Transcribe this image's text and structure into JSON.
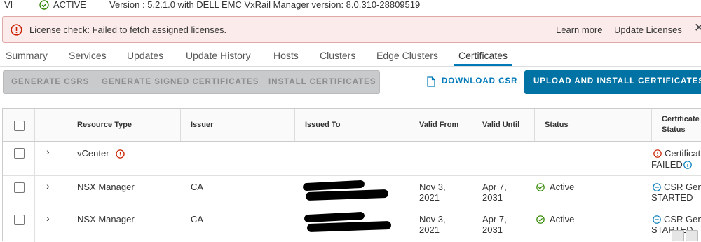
{
  "top": {
    "vi_label": "VI",
    "status": "ACTIVE",
    "version": "Version : 5.2.1.0 with DELL EMC VxRail Manager version: 8.0.310-28809519"
  },
  "alert": {
    "message": "License check: Failed to fetch assigned licenses.",
    "learn_more": "Learn more",
    "update_licenses": "Update Licenses",
    "close": "✕"
  },
  "tabs": [
    "Summary",
    "Services",
    "Updates",
    "Update History",
    "Hosts",
    "Clusters",
    "Edge Clusters",
    "Certificates"
  ],
  "active_tab": "Certificates",
  "toolbar": {
    "generate_csrs": "GENERATE CSRS",
    "generate_signed": "GENERATE SIGNED CERTIFICATES",
    "install_certs": "INSTALL CERTIFICATES",
    "download_csr": "DOWNLOAD CSR",
    "upload_install": "UPLOAD AND INSTALL CERTIFICATES"
  },
  "grid": {
    "columns": [
      "Resource Type",
      "Issuer",
      "Issued To",
      "Valid From",
      "Valid Until",
      "Status",
      "Certificate",
      "Status"
    ],
    "rows": [
      {
        "resource_type": "vCenter",
        "issuer": "",
        "valid_from_1": "",
        "valid_from_2": "",
        "valid_until_1": "",
        "valid_until_2": "",
        "status": "",
        "cert_status_1": "Certificat",
        "cert_status_2": "FAILED"
      },
      {
        "resource_type": "NSX Manager",
        "issuer": "CA",
        "valid_from_1": "Nov 3,",
        "valid_from_2": "2021",
        "valid_until_1": "Apr 7,",
        "valid_until_2": "2031",
        "status": "Active",
        "cert_status_1": "CSR Gene",
        "cert_status_2": "STARTED"
      },
      {
        "resource_type": "NSX Manager",
        "issuer": "CA",
        "valid_from_1": "Nov 3,",
        "valid_from_2": "2021",
        "valid_until_1": "Apr 7,",
        "valid_until_2": "2031",
        "status": "Active",
        "cert_status_1": "CSR Gene",
        "cert_status_2": "STARTED"
      }
    ]
  },
  "colors": {
    "accent": "#0079b8",
    "primary_button": "#0072a3",
    "error": "#c92100",
    "success": "#318700",
    "alert_bg": "#fbeceb"
  }
}
